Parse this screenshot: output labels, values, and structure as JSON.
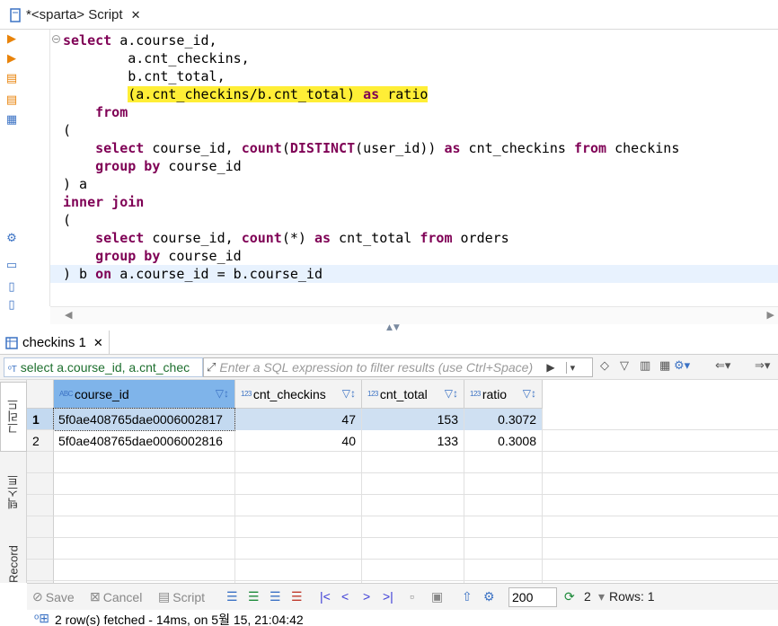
{
  "editor_tab": {
    "title": "*<sparta> Script",
    "close": "✕"
  },
  "sql_lines": [
    {
      "segments": [
        {
          "t": "select",
          "k": 1
        },
        {
          "t": " a.course_id,"
        }
      ]
    },
    {
      "segments": [
        {
          "t": "        a.cnt_checkins,"
        }
      ]
    },
    {
      "segments": [
        {
          "t": "        b.cnt_total,"
        }
      ]
    },
    {
      "segments": [
        {
          "t": "        "
        },
        {
          "t": "(a.cnt_checkins/b.cnt_total) ",
          "h": 1
        },
        {
          "t": "as",
          "k": 1,
          "h": 1
        },
        {
          "t": " ratio",
          "h": 1
        }
      ]
    },
    {
      "segments": [
        {
          "t": "    "
        },
        {
          "t": "from",
          "k": 1
        }
      ]
    },
    {
      "segments": [
        {
          "t": "("
        }
      ]
    },
    {
      "segments": [
        {
          "t": "    "
        },
        {
          "t": "select",
          "k": 1
        },
        {
          "t": " course_id, "
        },
        {
          "t": "count",
          "k": 1
        },
        {
          "t": "("
        },
        {
          "t": "DISTINCT",
          "k": 1
        },
        {
          "t": "(user_id)) "
        },
        {
          "t": "as",
          "k": 1
        },
        {
          "t": " cnt_checkins "
        },
        {
          "t": "from",
          "k": 1
        },
        {
          "t": " checkins"
        }
      ]
    },
    {
      "segments": [
        {
          "t": "    "
        },
        {
          "t": "group by",
          "k": 1
        },
        {
          "t": " course_id"
        }
      ]
    },
    {
      "segments": [
        {
          "t": ") a"
        }
      ]
    },
    {
      "segments": [
        {
          "t": "inner join",
          "k": 1
        }
      ]
    },
    {
      "segments": [
        {
          "t": "("
        }
      ]
    },
    {
      "segments": [
        {
          "t": "    "
        },
        {
          "t": "select",
          "k": 1
        },
        {
          "t": " course_id, "
        },
        {
          "t": "count",
          "k": 1
        },
        {
          "t": "(*) "
        },
        {
          "t": "as",
          "k": 1
        },
        {
          "t": " cnt_total "
        },
        {
          "t": "from",
          "k": 1
        },
        {
          "t": " orders"
        }
      ]
    },
    {
      "segments": [
        {
          "t": "    "
        },
        {
          "t": "group by",
          "k": 1
        },
        {
          "t": " course_id"
        }
      ]
    },
    {
      "segments": [
        {
          "t": ") b "
        },
        {
          "t": "on",
          "k": 1
        },
        {
          "t": " a.course_id = b.course_id"
        }
      ]
    }
  ],
  "results_tab": {
    "title": "checkins 1",
    "close": "✕"
  },
  "filter": {
    "query_preview": "select a.course_id, a.cnt_chec",
    "placeholder": "Enter a SQL expression to filter results (use Ctrl+Space)"
  },
  "side_tabs": {
    "grid": "그리드",
    "text": "텍스트",
    "record": "Record"
  },
  "columns": [
    {
      "name": "course_id",
      "type": "ABC"
    },
    {
      "name": "cnt_checkins",
      "type": "123"
    },
    {
      "name": "cnt_total",
      "type": "123"
    },
    {
      "name": "ratio",
      "type": "123"
    }
  ],
  "rows": [
    {
      "num": "1",
      "course_id": "5f0ae408765dae0006002817",
      "cnt_checkins": "47",
      "cnt_total": "153",
      "ratio": "0.3072"
    },
    {
      "num": "2",
      "course_id": "5f0ae408765dae0006002816",
      "cnt_checkins": "40",
      "cnt_total": "133",
      "ratio": "0.3008"
    }
  ],
  "toolbar": {
    "save": "Save",
    "cancel": "Cancel",
    "script": "Script",
    "page_size": "200",
    "refresh_count": "2",
    "rows_label": "Rows: 1"
  },
  "status": {
    "text": "2 row(s) fetched - 14ms, on 5월 15, 21:04:42"
  },
  "colors": {
    "keyword": "#7f0055",
    "highlight": "#ffee36",
    "selected_header": "#7fb4ea",
    "accent": "#3b72c4"
  }
}
